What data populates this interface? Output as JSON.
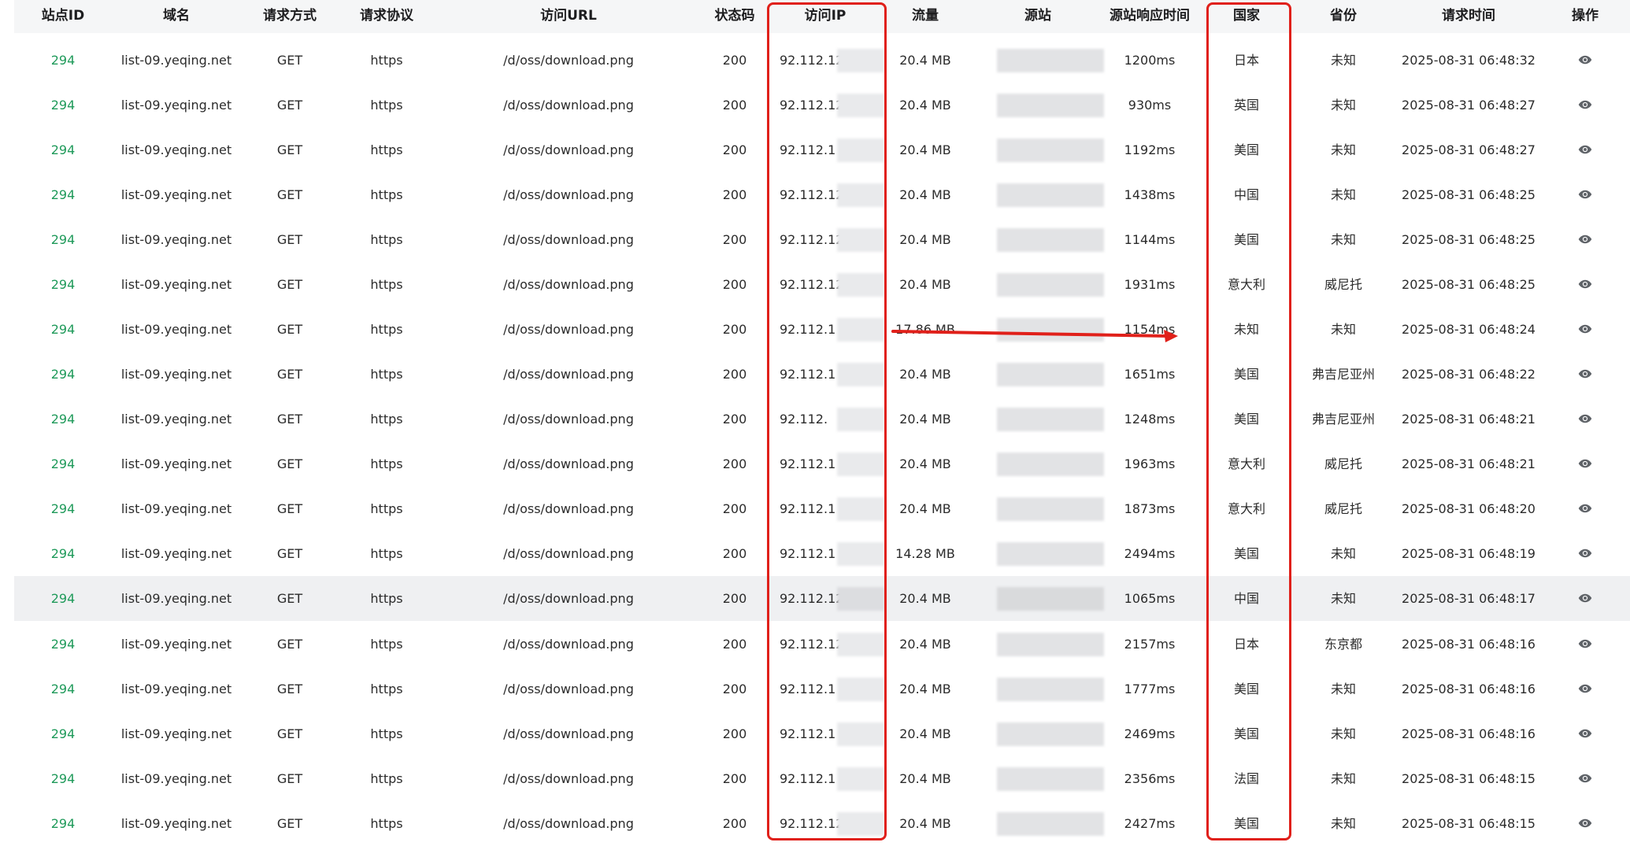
{
  "columns": [
    "站点ID",
    "域名",
    "请求方式",
    "请求协议",
    "访问URL",
    "状态码",
    "访问IP",
    "流量",
    "源站",
    "源站响应时间",
    "国家",
    "省份",
    "请求时间",
    "操作"
  ],
  "rows": [
    {
      "site_id": "294",
      "domain": "list-09.yeqing.net",
      "method": "GET",
      "protocol": "https",
      "url": "/d/oss/download.png",
      "status": "200",
      "ip": "92.112.12",
      "traffic": "20.4 MB",
      "origin": "",
      "resp_time": "1200ms",
      "country": "日本",
      "province": "未知",
      "time": "2025-08-31 06:48:32"
    },
    {
      "site_id": "294",
      "domain": "list-09.yeqing.net",
      "method": "GET",
      "protocol": "https",
      "url": "/d/oss/download.png",
      "status": "200",
      "ip": "92.112.12",
      "traffic": "20.4 MB",
      "origin": "",
      "resp_time": "930ms",
      "country": "英国",
      "province": "未知",
      "time": "2025-08-31 06:48:27"
    },
    {
      "site_id": "294",
      "domain": "list-09.yeqing.net",
      "method": "GET",
      "protocol": "https",
      "url": "/d/oss/download.png",
      "status": "200",
      "ip": "92.112.1",
      "traffic": "20.4 MB",
      "origin": "",
      "resp_time": "1192ms",
      "country": "美国",
      "province": "未知",
      "time": "2025-08-31 06:48:27"
    },
    {
      "site_id": "294",
      "domain": "list-09.yeqing.net",
      "method": "GET",
      "protocol": "https",
      "url": "/d/oss/download.png",
      "status": "200",
      "ip": "92.112.12",
      "traffic": "20.4 MB",
      "origin": "",
      "resp_time": "1438ms",
      "country": "中国",
      "province": "未知",
      "time": "2025-08-31 06:48:25"
    },
    {
      "site_id": "294",
      "domain": "list-09.yeqing.net",
      "method": "GET",
      "protocol": "https",
      "url": "/d/oss/download.png",
      "status": "200",
      "ip": "92.112.12",
      "traffic": "20.4 MB",
      "origin": "",
      "resp_time": "1144ms",
      "country": "美国",
      "province": "未知",
      "time": "2025-08-31 06:48:25"
    },
    {
      "site_id": "294",
      "domain": "list-09.yeqing.net",
      "method": "GET",
      "protocol": "https",
      "url": "/d/oss/download.png",
      "status": "200",
      "ip": "92.112.12",
      "traffic": "20.4 MB",
      "origin": "",
      "resp_time": "1931ms",
      "country": "意大利",
      "province": "威尼托",
      "time": "2025-08-31 06:48:25"
    },
    {
      "site_id": "294",
      "domain": "list-09.yeqing.net",
      "method": "GET",
      "protocol": "https",
      "url": "/d/oss/download.png",
      "status": "200",
      "ip": "92.112.1",
      "traffic": "17.86 MB",
      "origin": "",
      "resp_time": "1154ms",
      "country": "未知",
      "province": "未知",
      "time": "2025-08-31 06:48:24"
    },
    {
      "site_id": "294",
      "domain": "list-09.yeqing.net",
      "method": "GET",
      "protocol": "https",
      "url": "/d/oss/download.png",
      "status": "200",
      "ip": "92.112.1",
      "traffic": "20.4 MB",
      "origin": "",
      "resp_time": "1651ms",
      "country": "美国",
      "province": "弗吉尼亚州",
      "time": "2025-08-31 06:48:22"
    },
    {
      "site_id": "294",
      "domain": "list-09.yeqing.net",
      "method": "GET",
      "protocol": "https",
      "url": "/d/oss/download.png",
      "status": "200",
      "ip": "92.112.",
      "traffic": "20.4 MB",
      "origin": "",
      "resp_time": "1248ms",
      "country": "美国",
      "province": "弗吉尼亚州",
      "time": "2025-08-31 06:48:21"
    },
    {
      "site_id": "294",
      "domain": "list-09.yeqing.net",
      "method": "GET",
      "protocol": "https",
      "url": "/d/oss/download.png",
      "status": "200",
      "ip": "92.112.1",
      "traffic": "20.4 MB",
      "origin": "",
      "resp_time": "1963ms",
      "country": "意大利",
      "province": "威尼托",
      "time": "2025-08-31 06:48:21"
    },
    {
      "site_id": "294",
      "domain": "list-09.yeqing.net",
      "method": "GET",
      "protocol": "https",
      "url": "/d/oss/download.png",
      "status": "200",
      "ip": "92.112.1",
      "traffic": "20.4 MB",
      "origin": "",
      "resp_time": "1873ms",
      "country": "意大利",
      "province": "威尼托",
      "time": "2025-08-31 06:48:20"
    },
    {
      "site_id": "294",
      "domain": "list-09.yeqing.net",
      "method": "GET",
      "protocol": "https",
      "url": "/d/oss/download.png",
      "status": "200",
      "ip": "92.112.1",
      "traffic": "14.28 MB",
      "origin": "",
      "resp_time": "2494ms",
      "country": "美国",
      "province": "未知",
      "time": "2025-08-31 06:48:19"
    },
    {
      "site_id": "294",
      "domain": "list-09.yeqing.net",
      "method": "GET",
      "protocol": "https",
      "url": "/d/oss/download.png",
      "status": "200",
      "ip": "92.112.12",
      "traffic": "20.4 MB",
      "origin": "",
      "resp_time": "1065ms",
      "country": "中国",
      "province": "未知",
      "time": "2025-08-31 06:48:17"
    },
    {
      "site_id": "294",
      "domain": "list-09.yeqing.net",
      "method": "GET",
      "protocol": "https",
      "url": "/d/oss/download.png",
      "status": "200",
      "ip": "92.112.12",
      "traffic": "20.4 MB",
      "origin": "",
      "resp_time": "2157ms",
      "country": "日本",
      "province": "东京都",
      "time": "2025-08-31 06:48:16"
    },
    {
      "site_id": "294",
      "domain": "list-09.yeqing.net",
      "method": "GET",
      "protocol": "https",
      "url": "/d/oss/download.png",
      "status": "200",
      "ip": "92.112.1",
      "traffic": "20.4 MB",
      "origin": "",
      "resp_time": "1777ms",
      "country": "美国",
      "province": "未知",
      "time": "2025-08-31 06:48:16"
    },
    {
      "site_id": "294",
      "domain": "list-09.yeqing.net",
      "method": "GET",
      "protocol": "https",
      "url": "/d/oss/download.png",
      "status": "200",
      "ip": "92.112.1",
      "traffic": "20.4 MB",
      "origin": "",
      "resp_time": "2469ms",
      "country": "美国",
      "province": "未知",
      "time": "2025-08-31 06:48:16"
    },
    {
      "site_id": "294",
      "domain": "list-09.yeqing.net",
      "method": "GET",
      "protocol": "https",
      "url": "/d/oss/download.png",
      "status": "200",
      "ip": "92.112.1",
      "traffic": "20.4 MB",
      "origin": "",
      "resp_time": "2356ms",
      "country": "法国",
      "province": "未知",
      "time": "2025-08-31 06:48:15"
    },
    {
      "site_id": "294",
      "domain": "list-09.yeqing.net",
      "method": "GET",
      "protocol": "https",
      "url": "/d/oss/download.png",
      "status": "200",
      "ip": "92.112.12",
      "traffic": "20.4 MB",
      "origin": "",
      "resp_time": "2427ms",
      "country": "美国",
      "province": "未知",
      "time": "2025-08-31 06:48:15"
    }
  ],
  "hover_row_index": 12,
  "colors": {
    "site_id": "#1f9a5a",
    "highlight": "#e0201a",
    "header_bg": "#f5f6f7",
    "hover_bg": "#eff0f2"
  },
  "icons": {
    "action": "eye-icon",
    "annotation": "arrow-right"
  }
}
